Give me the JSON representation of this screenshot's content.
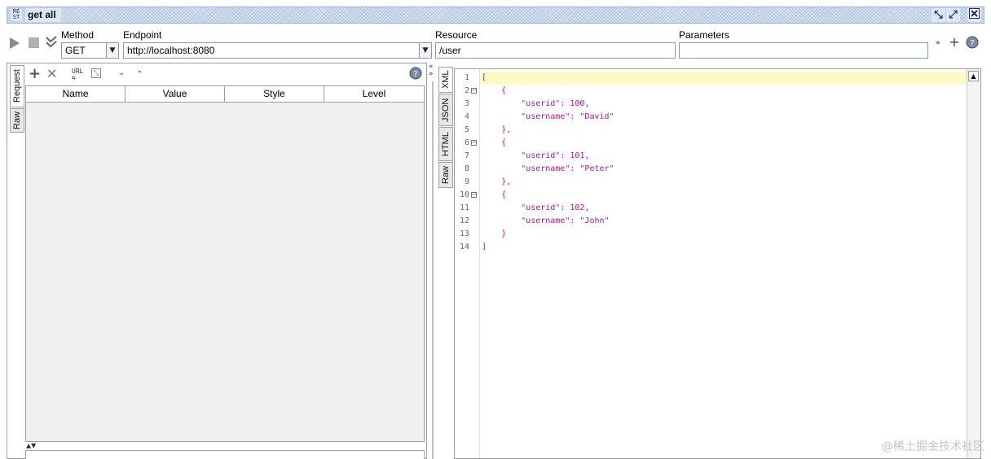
{
  "window": {
    "badge": "RE\nST",
    "title": "get all",
    "minimize_icon": "minimize-icon",
    "maximize_icon": "maximize-icon",
    "close_icon": "close-icon"
  },
  "toolbar": {
    "method_label": "Method",
    "method_value": "GET",
    "endpoint_label": "Endpoint",
    "endpoint_value": "http://localhost:8080",
    "resource_label": "Resource",
    "resource_value": "/user",
    "parameters_label": "Parameters",
    "parameters_value": ""
  },
  "request": {
    "tabs": [
      "Request",
      "Raw"
    ],
    "table_headers": [
      "Name",
      "Value",
      "Style",
      "Level"
    ]
  },
  "response": {
    "tabs": [
      "XML",
      "JSON",
      "HTML",
      "Raw"
    ],
    "lines": [
      "[",
      "    {",
      "        \"userid\": 100,",
      "        \"username\": \"David\"",
      "    },",
      "    {",
      "        \"userid\": 101,",
      "        \"username\": \"Peter\"",
      "    },",
      "    {",
      "        \"userid\": 102,",
      "        \"username\": \"John\"",
      "    }",
      "]"
    ],
    "fold_lines": [
      2,
      6,
      10
    ]
  },
  "watermark": "@稀土掘金技术社区"
}
